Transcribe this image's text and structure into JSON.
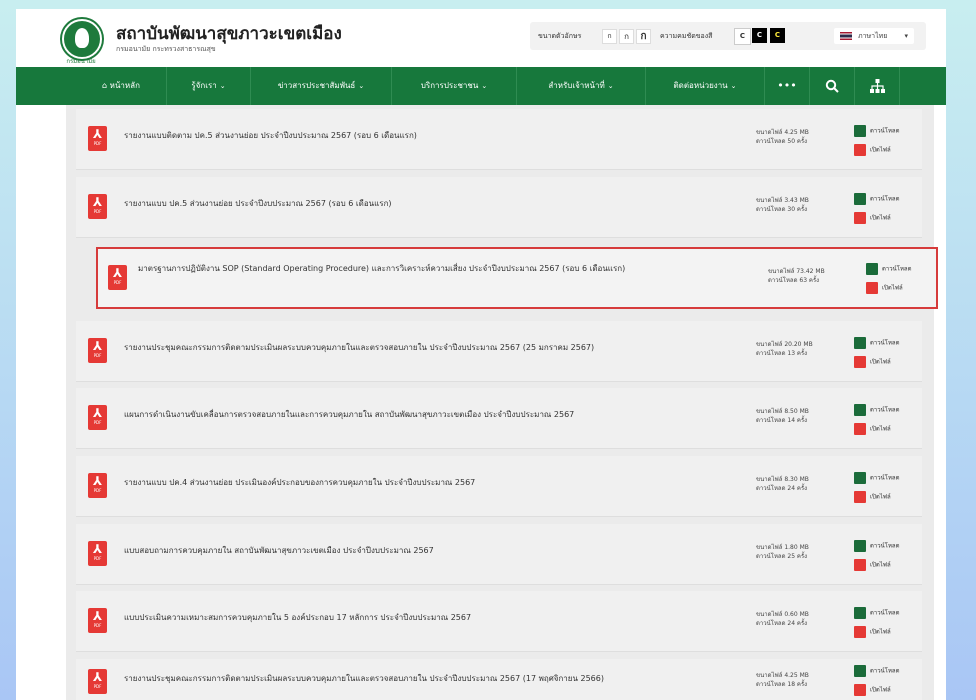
{
  "site": {
    "title": "สถาบันพัฒนาสุขภาวะเขตเมือง",
    "subtitle": "กรมอนามัย กระทรวงสาธารณสุข",
    "logo_caption": "กรมอนามัย"
  },
  "toolbar": {
    "font_size_label": "ขนาดตัวอักษร",
    "font_sizes": [
      "ก",
      "ก",
      "ก"
    ],
    "contrast_label": "ความคมชัดของสี",
    "contrast_options": [
      "C",
      "C",
      "C"
    ],
    "language": "ภาษาไทย"
  },
  "nav": {
    "items": [
      {
        "label": "หน้าหลัก",
        "icon": "home-icon"
      },
      {
        "label": "รู้จักเรา"
      },
      {
        "label": "ข่าวสารประชาสัมพันธ์"
      },
      {
        "label": "บริการประชาชน"
      },
      {
        "label": "สำหรับเจ้าหน้าที่"
      },
      {
        "label": "ติดต่อหน่วยงาน"
      }
    ],
    "more": "•••"
  },
  "documents": [
    {
      "title": "รายงานแบบติดตาม ปค.5 ส่วนงานย่อย ประจำปีงบประมาณ 2567 (รอบ 6 เดือนแรก)",
      "size": "ขนาดไฟล์ 4.25 MB",
      "downloads": "ดาวน์โหลด 50 ครั้ง"
    },
    {
      "title": "รายงานแบบ ปค.5 ส่วนงานย่อย ประจำปีงบประมาณ 2567 (รอบ 6 เดือนแรก)",
      "size": "ขนาดไฟล์ 3.43 MB",
      "downloads": "ดาวน์โหลด 30 ครั้ง"
    },
    {
      "title": "มาตรฐานการปฏิบัติงาน SOP (Standard Operating Procedure) และการวิเคราะห์ความเสี่ยง ประจำปีงบประมาณ 2567 (รอบ 6 เดือนแรก)",
      "size": "ขนาดไฟล์ 73.42 MB",
      "downloads": "ดาวน์โหลด 63 ครั้ง"
    },
    {
      "title": "รายงานประชุมคณะกรรมการติดตามประเมินผลระบบควบคุมภายในและตรวจสอบภายใน ประจำปีงบประมาณ 2567 (25 มกราคม 2567)",
      "size": "ขนาดไฟล์ 20.20 MB",
      "downloads": "ดาวน์โหลด 13 ครั้ง"
    },
    {
      "title": "แผนการดำเนินงานขับเคลื่อนการตรวจสอบภายในและการควบคุมภายใน สถาบันพัฒนาสุขภาวะเขตเมือง ประจำปีงบประมาณ 2567",
      "size": "ขนาดไฟล์ 8.50 MB",
      "downloads": "ดาวน์โหลด 14 ครั้ง"
    },
    {
      "title": "รายงานแบบ ปค.4 ส่วนงานย่อย ประเมินองค์ประกอบของการควบคุมภายใน ประจำปีงบประมาณ 2567",
      "size": "ขนาดไฟล์ 8.30 MB",
      "downloads": "ดาวน์โหลด 24 ครั้ง"
    },
    {
      "title": "แบบสอบถามการควบคุมภายใน สถาบันพัฒนาสุขภาวะเขตเมือง ประจำปีงบประมาณ 2567",
      "size": "ขนาดไฟล์ 1.80 MB",
      "downloads": "ดาวน์โหลด 25 ครั้ง"
    },
    {
      "title": "แบบประเมินความเหมาะสมการควบคุมภายใน 5 องค์ประกอบ 17 หลักการ ประจำปีงบประมาณ 2567",
      "size": "ขนาดไฟล์ 0.60 MB",
      "downloads": "ดาวน์โหลด 24 ครั้ง"
    },
    {
      "title": "รายงานประชุมคณะกรรมการติดตามประเมินผลระบบควบคุมภายในและตรวจสอบภายใน ประจำปีงบประมาณ 2567 (17 พฤศจิกายน 2566)",
      "size": "ขนาดไฟล์ 4.25 MB",
      "downloads": "ดาวน์โหลด 18 ครั้ง"
    }
  ],
  "actions": {
    "download": "ดาวน์โหลด",
    "preview": "เปิดไฟล์"
  },
  "pdf_badge": "PDF",
  "colors": {
    "nav_green": "#17783c",
    "pdf_red": "#e53935",
    "highlight_border": "#d63b3b"
  },
  "highlighted_row": 2
}
